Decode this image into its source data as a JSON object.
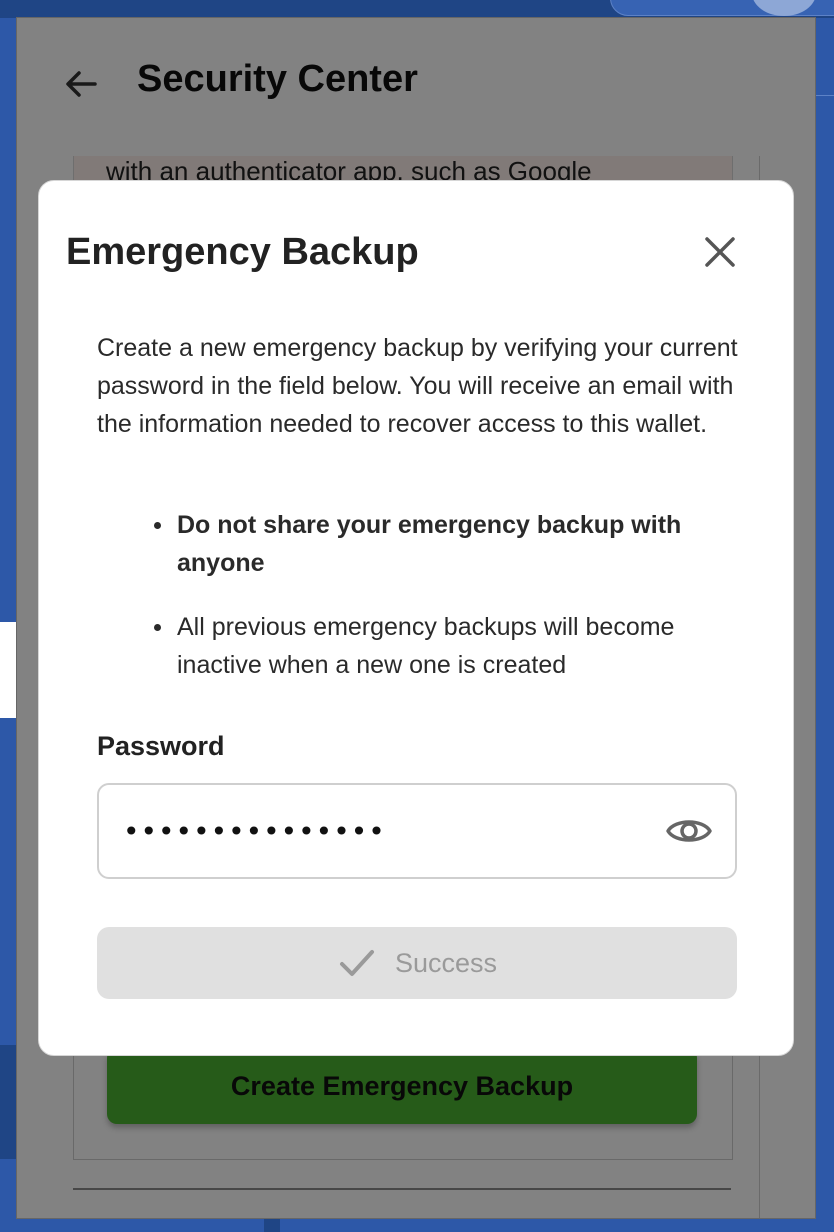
{
  "page": {
    "title": "Security Center",
    "background_text": "with an authenticator app, such as Google",
    "create_button_label": "Create Emergency Backup"
  },
  "modal": {
    "title": "Emergency Backup",
    "description": "Create a new emergency backup by verifying your current password in the field below. You will receive an email with the information needed to recover access to this wallet.",
    "bullets": [
      "Do not share your emergency backup with anyone",
      "All previous emergency backups will become inactive when a new one is created"
    ],
    "password_label": "Password",
    "password_value": "•••••••••••••••",
    "success_label": "Success"
  },
  "icons": {
    "back": "arrow-left-icon",
    "close": "close-icon",
    "eye": "eye-icon",
    "check": "check-icon"
  },
  "colors": {
    "background_blue": "#2d58a8",
    "create_button_green": "#4bb331",
    "success_button_bg": "#e0e0e0"
  }
}
